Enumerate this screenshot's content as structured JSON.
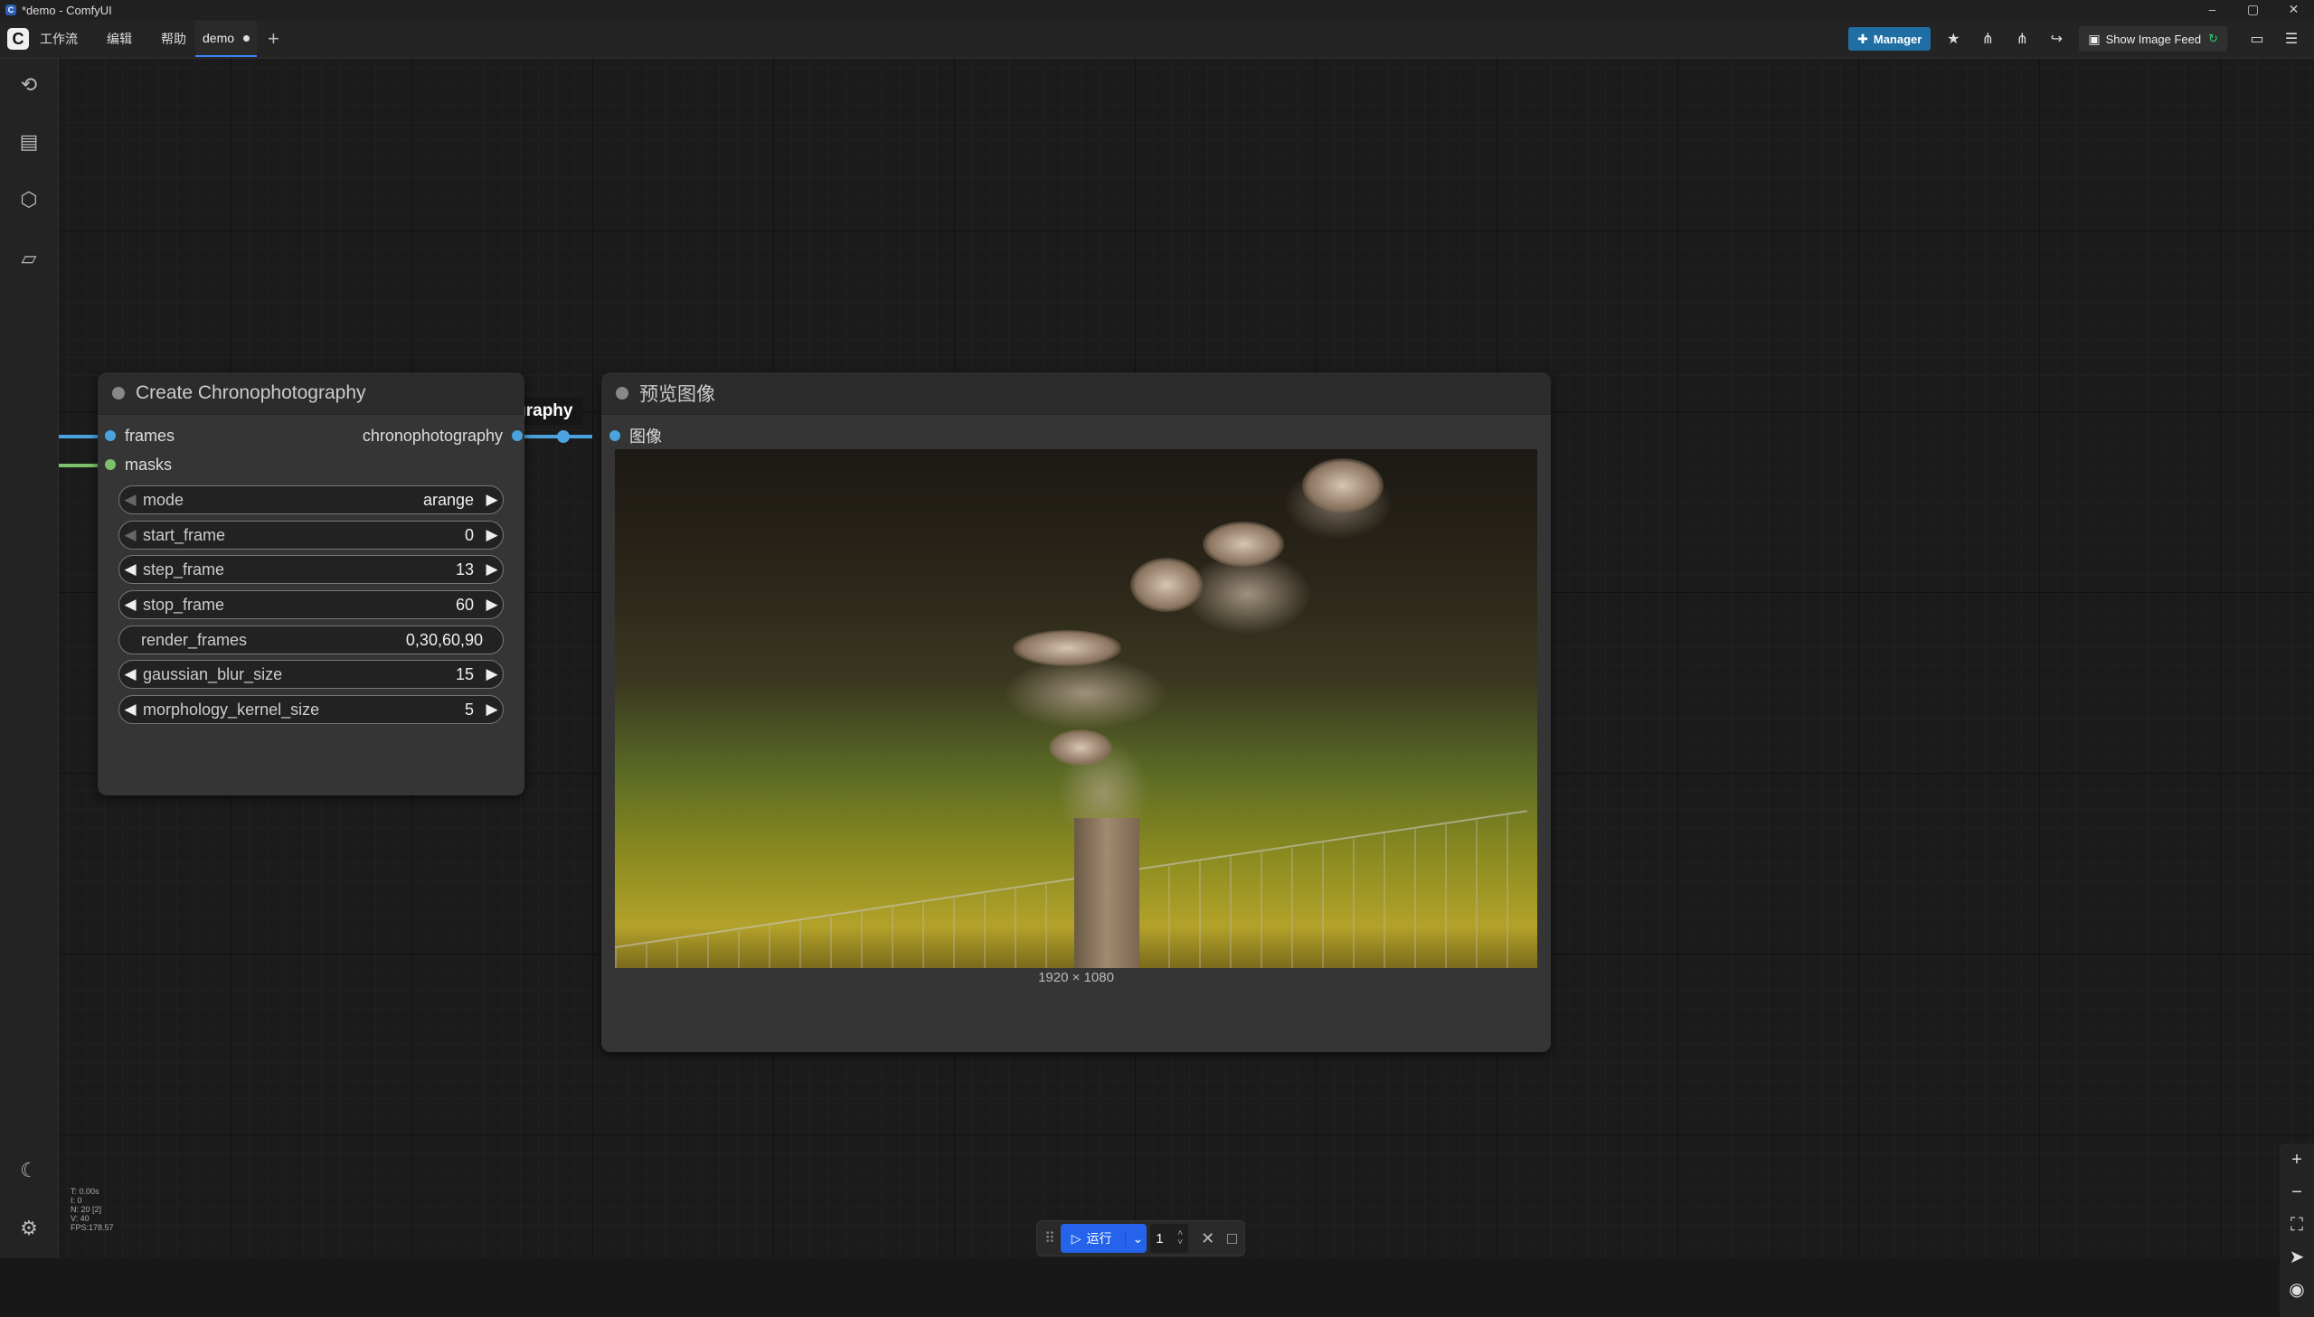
{
  "window": {
    "title": "*demo - ComfyUI",
    "controls": [
      "–",
      "▢",
      "✕"
    ]
  },
  "menubar": {
    "menus": [
      "工作流",
      "编辑",
      "帮助"
    ],
    "tab": {
      "label": "demo"
    },
    "add_tab": "+",
    "manager_label": "Manager",
    "show_image_feed_label": "Show Image Feed"
  },
  "canvas": {
    "group_label": "chronophotography",
    "create_node": {
      "title": "Create Chronophotography",
      "inputs": [
        {
          "label": "frames",
          "color": "#4aa3df"
        },
        {
          "label": "masks",
          "color": "#7bc26b"
        }
      ],
      "output": {
        "label": "chronophotography",
        "color": "#4aa3df"
      },
      "widgets": [
        {
          "label": "mode",
          "value": "arange",
          "type": "combo"
        },
        {
          "label": "start_frame",
          "value": "0",
          "type": "number"
        },
        {
          "label": "step_frame",
          "value": "13",
          "type": "number"
        },
        {
          "label": "stop_frame",
          "value": "60",
          "type": "number"
        },
        {
          "label": "render_frames",
          "value": "0,30,60,90",
          "type": "text"
        },
        {
          "label": "gaussian_blur_size",
          "value": "15",
          "type": "number"
        },
        {
          "label": "morphology_kernel_size",
          "value": "5",
          "type": "number"
        }
      ]
    },
    "preview_node": {
      "title": "预览图像",
      "input": {
        "label": "图像",
        "color": "#4aa3df"
      },
      "image_dims": "1920 × 1080"
    }
  },
  "stats": [
    "T: 0.00s",
    "I: 0",
    "N: 20 [2]",
    "V: 40",
    "FPS:178.57"
  ],
  "runbar": {
    "run_label": "运行",
    "batch_count": "1"
  },
  "colors": {
    "accent": "#2563eb",
    "manager": "#1f6fa5",
    "link_image": "#4aa3df",
    "link_mask": "#7bc26b"
  },
  "icons": {
    "sidebar_top": [
      "history-icon",
      "queue-icon",
      "model-library-icon",
      "workflows-icon"
    ],
    "sidebar_bottom": [
      "theme-icon",
      "settings-icon"
    ],
    "zoom": [
      "zoom-in-icon",
      "zoom-out-icon",
      "fit-view-icon",
      "select-mode-icon",
      "toggle-links-icon"
    ]
  }
}
